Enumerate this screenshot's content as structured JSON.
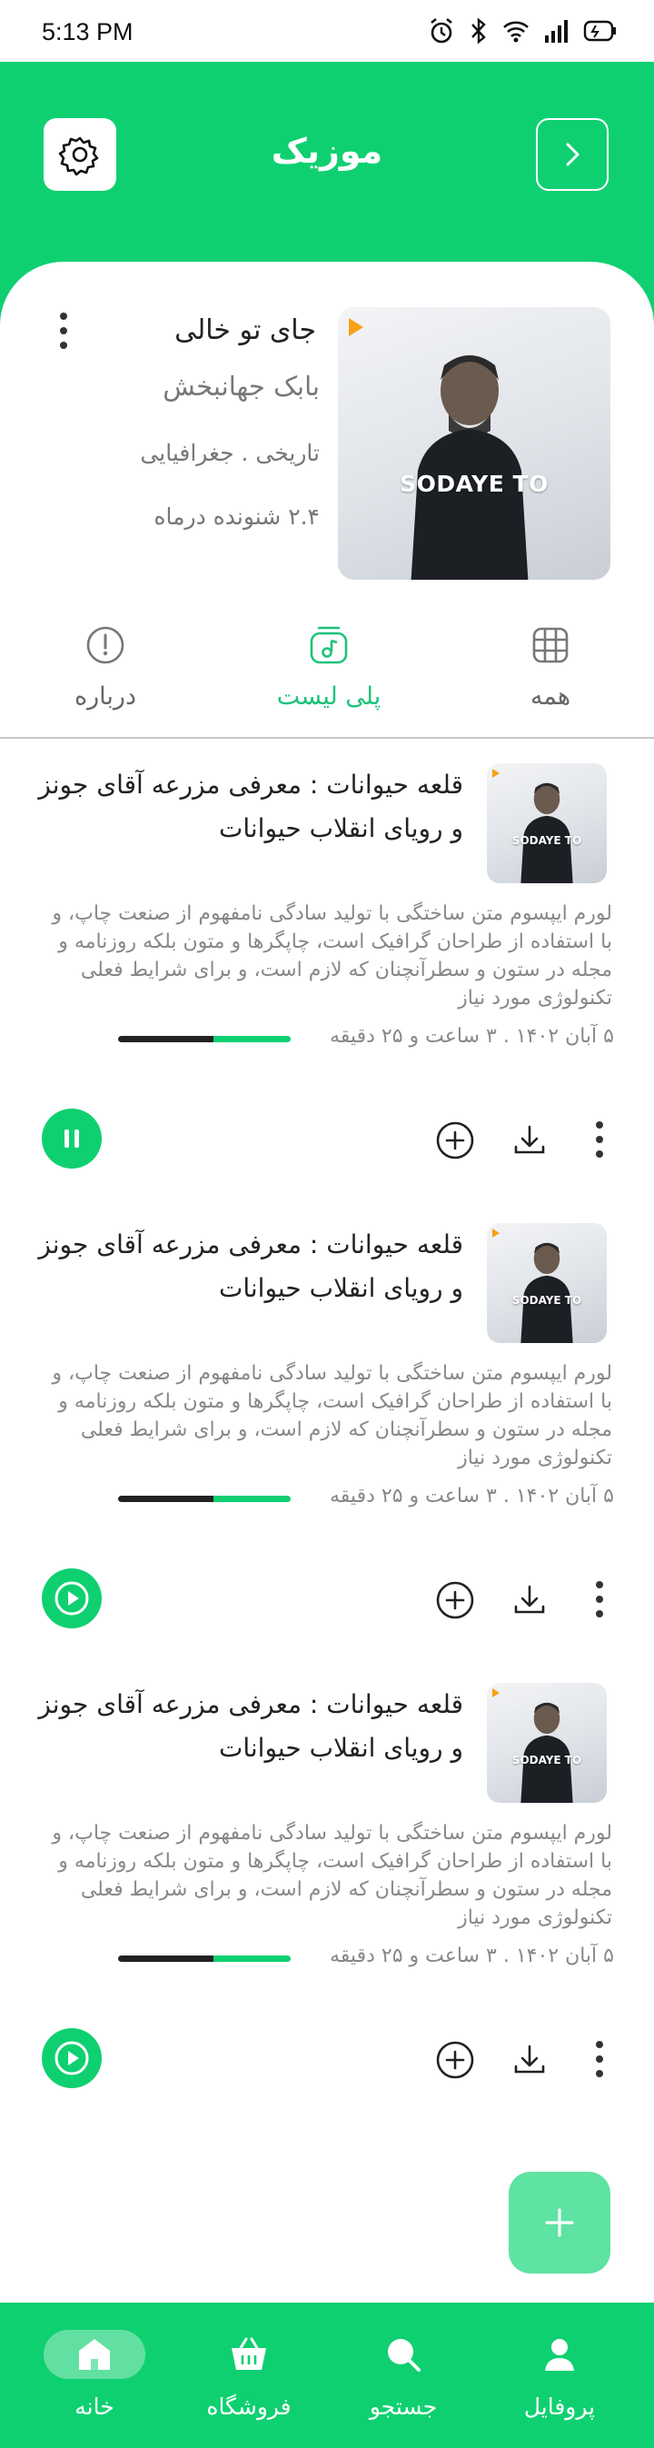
{
  "status_bar": {
    "time": "5:13 PM"
  },
  "header": {
    "title": "موزیک"
  },
  "song": {
    "title": "جای تو خالی",
    "artist": "بابک جهانبخش",
    "genre": "تاریخی . جغرافیایی",
    "listeners": "۲.۴ شنونده درماه",
    "cover_text": "SODAYE TO"
  },
  "tabs": [
    {
      "label": "همه",
      "icon": "grid-icon",
      "active": false
    },
    {
      "label": "پلی لیست",
      "icon": "playlist-icon",
      "active": true
    },
    {
      "label": "درباره",
      "icon": "info-icon",
      "active": false
    }
  ],
  "episodes": [
    {
      "title": "قلعه حیوانات : معرفی مزرعه آقای جونز و رویای انقلاب حیوانات",
      "description": "لورم ایپسوم متن ساختگی با تولید سادگی نامفهوم از صنعت چاپ، و با استفاده از طراحان گرافیک است، چاپگرها و متون بلکه روزنامه و مجله در ستون و سطرآنچنان که لازم است، و برای شرایط فعلی تکنولوژی مورد نیاز",
      "meta": "۵ آبان ۱۴۰۲ . ۳ ساعت و ۲۵ دقیقه",
      "progress": 0.55,
      "state": "playing",
      "cover_text": "SODAYE TO"
    },
    {
      "title": "قلعه حیوانات : معرفی مزرعه آقای جونز و رویای انقلاب حیوانات",
      "description": "لورم ایپسوم متن ساختگی با تولید سادگی نامفهوم از صنعت چاپ، و با استفاده از طراحان گرافیک است، چاپگرها و متون بلکه روزنامه و مجله در ستون و سطرآنچنان که لازم است، و برای شرایط فعلی تکنولوژی مورد نیاز",
      "meta": "۵ آبان ۱۴۰۲ . ۳ ساعت و ۲۵ دقیقه",
      "progress": 0.55,
      "state": "paused",
      "cover_text": "SODAYE TO"
    },
    {
      "title": "قلعه حیوانات : معرفی مزرعه آقای جونز و رویای انقلاب حیوانات",
      "description": "لورم ایپسوم متن ساختگی با تولید سادگی نامفهوم از صنعت چاپ، و با استفاده از طراحان گرافیک است، چاپگرها و متون بلکه روزنامه و مجله در ستون و سطرآنچنان که لازم است، و برای شرایط فعلی تکنولوژی مورد نیاز",
      "meta": "۵ آبان ۱۴۰۲ . ۳ ساعت و ۲۵ دقیقه",
      "progress": 0.55,
      "state": "paused",
      "cover_text": "SODAYE TO"
    }
  ],
  "bottom_nav": [
    {
      "label": "پروفایل",
      "icon": "profile-icon",
      "active": false
    },
    {
      "label": "جستجو",
      "icon": "search-icon",
      "active": false
    },
    {
      "label": "فروشگاه",
      "icon": "basket-icon",
      "active": false
    },
    {
      "label": "خانه",
      "icon": "home-icon",
      "active": true
    }
  ],
  "colors": {
    "accent": "#0fd071",
    "fab": "#5ee3a2",
    "tab_active": "#1ec27a"
  }
}
